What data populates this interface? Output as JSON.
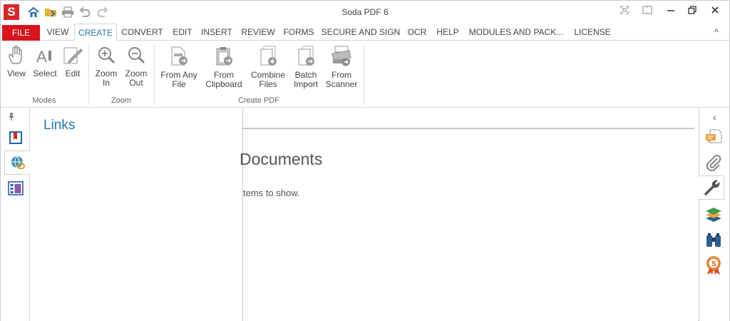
{
  "app": {
    "title": "Soda PDF 6",
    "logo_letter": "S"
  },
  "quick_access": [
    "home-icon",
    "open-folder-icon",
    "print-icon",
    "undo-icon",
    "redo-icon"
  ],
  "window_controls": [
    "fullscreen-icon",
    "reading-mode-icon",
    "minimize-icon",
    "restore-icon",
    "close-icon"
  ],
  "menu": {
    "tabs": [
      "FILE",
      "VIEW",
      "CREATE",
      "CONVERT",
      "EDIT",
      "INSERT",
      "REVIEW",
      "FORMS",
      "SECURE AND SIGN",
      "OCR",
      "HELP",
      "MODULES AND PACK...",
      "LICENSE"
    ],
    "active": "CREATE",
    "collapse_icon": "^"
  },
  "ribbon": {
    "groups": [
      {
        "label": "Modes",
        "buttons": [
          {
            "line1": "View",
            "line2": "",
            "icon": "hand-icon"
          },
          {
            "line1": "Select",
            "line2": "",
            "icon": "select-text-icon"
          },
          {
            "line1": "Edit",
            "line2": "",
            "icon": "edit-icon"
          }
        ]
      },
      {
        "label": "Zoom",
        "buttons": [
          {
            "line1": "Zoom",
            "line2": "In",
            "icon": "zoom-in-icon"
          },
          {
            "line1": "Zoom",
            "line2": "Out",
            "icon": "zoom-out-icon"
          }
        ]
      },
      {
        "label": "Create PDF",
        "buttons": [
          {
            "line1": "From Any",
            "line2": "File",
            "icon": "from-file-icon"
          },
          {
            "line1": "From",
            "line2": "Clipboard",
            "icon": "clipboard-icon"
          },
          {
            "line1": "Combine",
            "line2": "Files",
            "icon": "combine-icon"
          },
          {
            "line1": "Batch",
            "line2": "Import",
            "icon": "batch-icon"
          },
          {
            "line1": "From",
            "line2": "Scanner",
            "icon": "scanner-icon"
          }
        ]
      }
    ]
  },
  "left_panel": {
    "title": "Links",
    "pin_icon": "pin-icon",
    "icons": [
      "bookmarks-icon",
      "links-icon",
      "thumbnails-icon"
    ],
    "active_index": 1
  },
  "document": {
    "title": "Documents",
    "empty_message": "tems to show."
  },
  "right_panel": {
    "collapse_glyph": "‹",
    "icons": [
      "comments-icon",
      "attachments-icon",
      "properties-icon",
      "layers-icon",
      "search-icon",
      "certificate-icon"
    ],
    "active_index": 2
  }
}
